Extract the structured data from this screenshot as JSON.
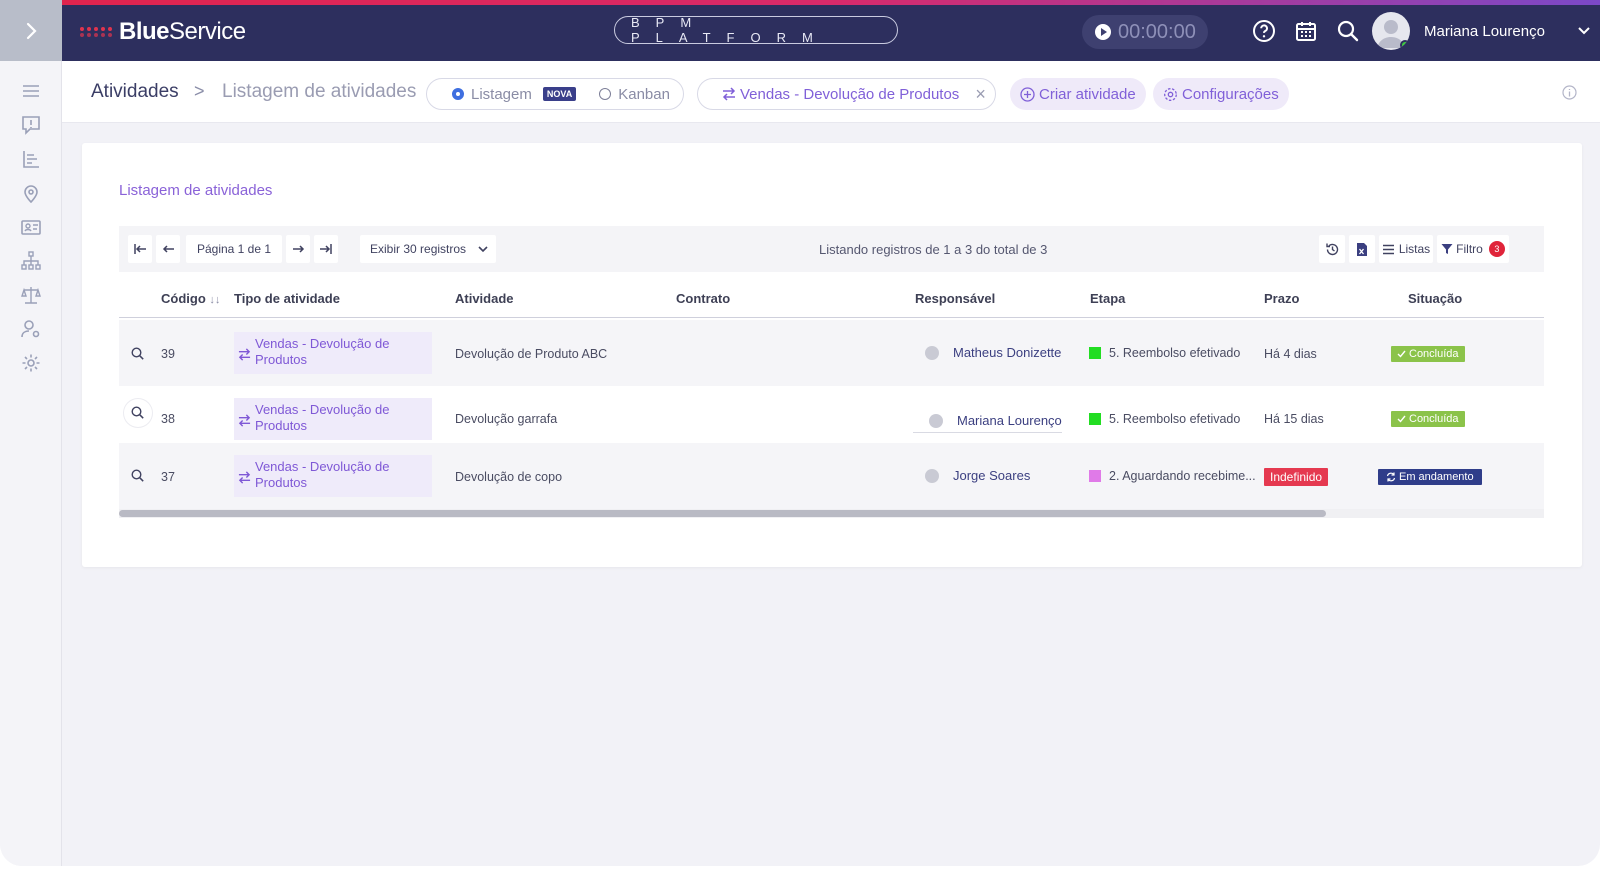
{
  "app": {
    "brand_bold": "Blue",
    "brand_light": "Service",
    "platform_label": "BPM PLATFORM",
    "timer": "00:00:00",
    "user_name": "Mariana Lourenço",
    "colors": {
      "topbar": "#2d2f5e",
      "accent": "#8060d8",
      "success": "#8bc34a",
      "danger": "#e53950",
      "progress": "#2f3d8a"
    }
  },
  "icons": {
    "sidebar_toggle": "chevron-right-icon",
    "help": "help-circle-icon",
    "calendar": "calendar-icon",
    "search": "search-icon",
    "user_menu": "chevron-down-icon",
    "sidebar": [
      "menu-icon",
      "alert-message-icon",
      "list-chart-icon",
      "location-pin-icon",
      "id-card-icon",
      "hierarchy-icon",
      "scale-icon",
      "user-settings-icon",
      "gear-icon"
    ]
  },
  "breadcrumb": {
    "root": "Atividades",
    "separator": ">",
    "current": "Listagem de atividades"
  },
  "view_toggle": {
    "listagem": "Listagem",
    "nova_badge": "NOVA",
    "kanban": "Kanban"
  },
  "filter_chip": {
    "label": "Vendas - Devolução de Produtos",
    "close": "×"
  },
  "actions": {
    "create": "Criar atividade",
    "settings": "Configurações"
  },
  "card": {
    "title": "Listagem de atividades",
    "pagination": {
      "page_label": "Página 1 de 1",
      "page_size": "Exibir 30 registros"
    },
    "listing_status": "Listando registros de 1 a 3 do total de 3",
    "tools": {
      "lists": "Listas",
      "filter": "Filtro",
      "filter_count": "3"
    }
  },
  "table": {
    "headers": {
      "codigo": "Código",
      "sort_indicator": "↓↓",
      "tipo": "Tipo de atividade",
      "atividade": "Atividade",
      "contrato": "Contrato",
      "responsavel": "Responsável",
      "etapa": "Etapa",
      "prazo": "Prazo",
      "situacao": "Situação"
    },
    "rows": [
      {
        "codigo": "39",
        "tipo": "Vendas - Devolução de Produtos",
        "atividade": "Devolução de Produto ABC",
        "contrato": "",
        "responsavel": "Matheus Donizette",
        "etapa": "5. Reembolso efetivado",
        "etapa_color": "#22dd22",
        "prazo": "Há 4 dias",
        "situacao": "Concluída"
      },
      {
        "codigo": "38",
        "tipo": "Vendas - Devolução de Produtos",
        "atividade": "Devolução garrafa",
        "contrato": "",
        "responsavel": "Mariana Lourenço",
        "etapa": "5. Reembolso efetivado",
        "etapa_color": "#22dd22",
        "prazo": "Há 15 dias",
        "situacao": "Concluída"
      },
      {
        "codigo": "37",
        "tipo": "Vendas - Devolução de Produtos",
        "atividade": "Devolução de copo",
        "contrato": "",
        "responsavel": "Jorge Soares",
        "etapa": "2. Aguardando recebime...",
        "etapa_color": "#e07ae8",
        "prazo": "Indefinido",
        "situacao": "Em andamento"
      }
    ]
  }
}
